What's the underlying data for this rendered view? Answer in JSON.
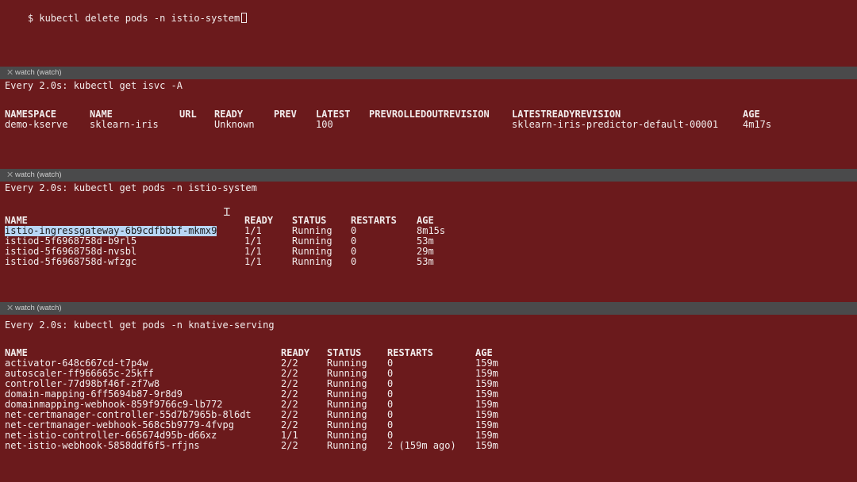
{
  "top": {
    "prompt": "$ kubectl delete pods -n istio-system"
  },
  "panes": [
    {
      "tab_title": "watch (watch)",
      "command": "Every 2.0s: kubectl get isvc -A",
      "headers": [
        "NAMESPACE",
        "NAME",
        "URL",
        "READY",
        "PREV",
        "LATEST",
        "PREVROLLEDOUTREVISION",
        "LATESTREADYREVISION",
        "AGE"
      ],
      "rows": [
        [
          "demo-kserve",
          "sklearn-iris",
          "",
          "Unknown",
          "",
          "100",
          "",
          "sklearn-iris-predictor-default-00001",
          "4m17s"
        ]
      ]
    },
    {
      "tab_title": "watch (watch)",
      "command": "Every 2.0s: kubectl get pods -n istio-system",
      "headers": [
        "NAME",
        "READY",
        "STATUS",
        "RESTARTS",
        "AGE"
      ],
      "rows": [
        [
          "istio-ingressgateway-6b9cdfbbbf-mkmx9",
          "1/1",
          "Running",
          "0",
          "8m15s"
        ],
        [
          "istiod-5f6968758d-b9rl5",
          "1/1",
          "Running",
          "0",
          "53m"
        ],
        [
          "istiod-5f6968758d-nvsbl",
          "1/1",
          "Running",
          "0",
          "29m"
        ],
        [
          "istiod-5f6968758d-wfzgc",
          "1/1",
          "Running",
          "0",
          "53m"
        ]
      ]
    },
    {
      "tab_title": "watch (watch)",
      "command": "Every 2.0s: kubectl get pods -n knative-serving",
      "headers": [
        "NAME",
        "READY",
        "STATUS",
        "RESTARTS",
        "AGE"
      ],
      "rows": [
        [
          "activator-648c667cd-t7p4w",
          "2/2",
          "Running",
          "0",
          "159m"
        ],
        [
          "autoscaler-ff966665c-25kff",
          "2/2",
          "Running",
          "0",
          "159m"
        ],
        [
          "controller-77d98bf46f-zf7w8",
          "2/2",
          "Running",
          "0",
          "159m"
        ],
        [
          "domain-mapping-6ff5694b87-9r8d9",
          "2/2",
          "Running",
          "0",
          "159m"
        ],
        [
          "domainmapping-webhook-859f9766c9-lb772",
          "2/2",
          "Running",
          "0",
          "159m"
        ],
        [
          "net-certmanager-controller-55d7b7965b-8l6dt",
          "2/2",
          "Running",
          "0",
          "159m"
        ],
        [
          "net-certmanager-webhook-568c5b9779-4fvpg",
          "2/2",
          "Running",
          "0",
          "159m"
        ],
        [
          "net-istio-controller-665674d95b-d66xz",
          "1/1",
          "Running",
          "0",
          "159m"
        ],
        [
          "net-istio-webhook-5858ddf6f5-rfjns",
          "2/2",
          "Running",
          "2 (159m ago)",
          "159m"
        ]
      ]
    }
  ],
  "colors": {
    "background": "#6b1a1c",
    "tabbar": "#4a4a4b",
    "selection": "#b8d6f5"
  },
  "icons": {
    "close": "close-icon",
    "text_cursor": "ibeam-cursor-icon"
  }
}
